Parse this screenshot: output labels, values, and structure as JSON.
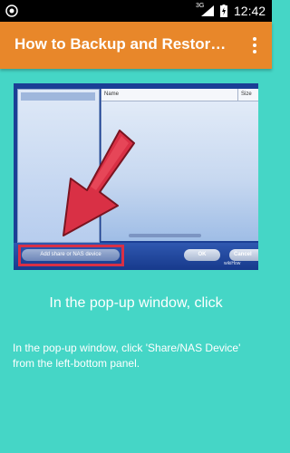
{
  "status_bar": {
    "time": "12:42",
    "network": "3G",
    "icons": [
      "notification-icon",
      "signal-icon",
      "battery-charging-icon"
    ]
  },
  "app_bar": {
    "title": "How to Backup and Restor…",
    "menu_icon": "overflow-menu-icon",
    "color": "#e8872a"
  },
  "screenshot": {
    "list_columns": [
      "Name",
      "Size"
    ],
    "add_button": "Add share or NAS device",
    "ok_button": "OK",
    "cancel_button": "Cancel",
    "watermark": "wikiHow",
    "arrow_color": "#d93045"
  },
  "content": {
    "heading": "In the pop-up window, click",
    "description": "In the pop-up window, click 'Share/NAS Device' from the left-bottom panel."
  },
  "colors": {
    "background": "#45d6c6",
    "highlight": "#d93045"
  }
}
